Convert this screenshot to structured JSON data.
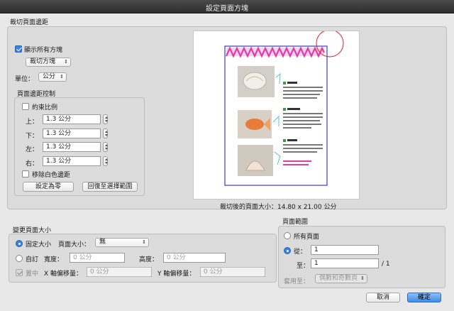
{
  "window": {
    "title": "設定頁面方塊"
  },
  "crop_margins": {
    "group_label": "裁切頁面邊距",
    "show_all_boxes": {
      "label": "顯示所有方塊",
      "checked": true
    },
    "box_select": {
      "value": "裁切方塊"
    },
    "units": {
      "label": "單位：",
      "value": "公分"
    },
    "controls": {
      "label": "頁面邊距控制",
      "constrain": {
        "label": "約束比例",
        "checked": false
      },
      "top": {
        "label": "上：",
        "value": "1.3 公分"
      },
      "bottom": {
        "label": "下：",
        "value": "1.3 公分"
      },
      "left": {
        "label": "左：",
        "value": "1.3 公分"
      },
      "right": {
        "label": "右：",
        "value": "1.3 公分"
      },
      "remove_white": {
        "label": "移除白色邊距",
        "checked": false
      },
      "set_zero_button": "設定為零",
      "revert_button": "回復至選擇範圍"
    },
    "cropped_size": "裁切後的頁面大小：14.80 x 21.00 公分",
    "preview_texts": [
      "電熱",
      "電熱鼓風機",
      "電熱電熱"
    ]
  },
  "change_page_size": {
    "group_label": "變更頁面大小",
    "fixed_size": {
      "label": "固定大小",
      "checked": true
    },
    "page_size": {
      "label": "頁面大小：",
      "value": "無"
    },
    "custom": {
      "label": "自訂",
      "checked": false
    },
    "width": {
      "label": "寬度：",
      "placeholder": "0 公分"
    },
    "height": {
      "label": "高度：",
      "placeholder": "0 公分"
    },
    "center": {
      "label": "置中",
      "checked": true,
      "disabled": true
    },
    "x_offset": {
      "label": "X 軸偏移量：",
      "placeholder": "0 公分"
    },
    "y_offset": {
      "label": "Y 軸偏移量：",
      "placeholder": "0 公分"
    }
  },
  "page_range": {
    "group_label": "頁面範圍",
    "all_pages": {
      "label": "所有頁面",
      "checked": false
    },
    "from": {
      "label": "從：",
      "value": "1",
      "checked": true
    },
    "to": {
      "label": "至：",
      "value": "1",
      "total": "/ 1"
    },
    "apply_to": {
      "label": "套用至：",
      "value": "偶數和奇數頁"
    }
  },
  "footer": {
    "cancel": "取消",
    "ok": "確定"
  },
  "colors": {
    "accent": "#3b82e0",
    "page_border": "#3b3bb8",
    "zigzag": "#e03ca8",
    "callout": "#5bc3d6",
    "highlight_circle": "#e02020"
  }
}
